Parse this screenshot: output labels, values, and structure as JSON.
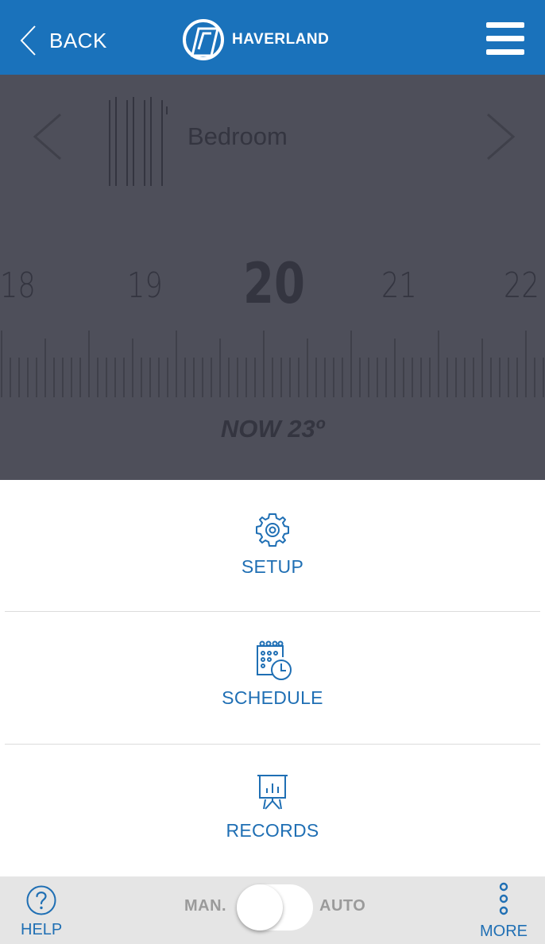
{
  "header": {
    "back_label": "BACK",
    "brand_name": "HAVERLAND",
    "menu_icon": "hamburger-menu-icon",
    "background_color": "#1a72bb"
  },
  "thermostat": {
    "room_name": "Bedroom",
    "scale_values": [
      "18",
      "19",
      "20",
      "21",
      "22"
    ],
    "selected_value": "20",
    "now_label": "NOW 23º",
    "overlay_color": "#4e4f5a"
  },
  "options": {
    "setup": {
      "label": "SETUP",
      "icon": "gear-icon"
    },
    "schedule": {
      "label": "SCHEDULE",
      "icon": "calendar-clock-icon"
    },
    "records": {
      "label": "RECORDS",
      "icon": "presentation-chart-icon"
    }
  },
  "footer": {
    "help_label": "HELP",
    "mode_manual": "MAN.",
    "mode_auto": "AUTO",
    "more_label": "MORE",
    "accent_color": "#1f6fb4"
  }
}
